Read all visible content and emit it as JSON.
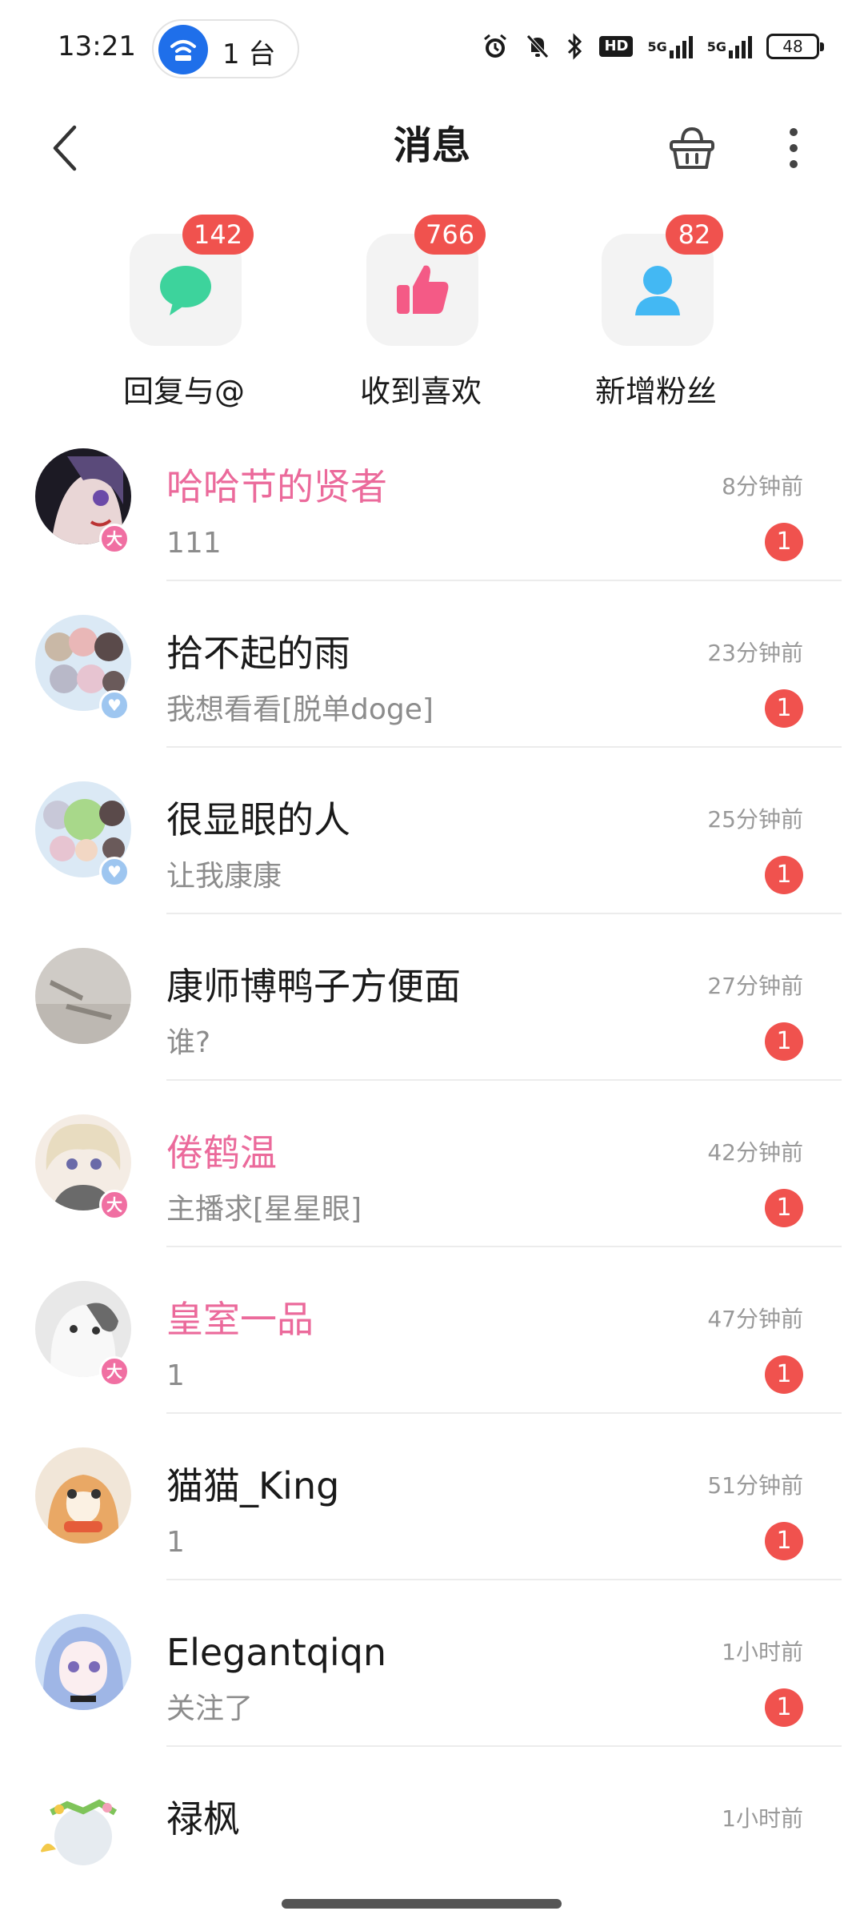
{
  "status_bar": {
    "time": "13:21",
    "hotspot_label": "1 台",
    "network_1": "5G",
    "network_2": "5G",
    "hd_label": "HD",
    "battery": "48"
  },
  "header": {
    "title": "消息"
  },
  "quick_entries": [
    {
      "label": "回复与@",
      "count": "142",
      "icon": "chat-bubble-icon",
      "color": "#3dd39c"
    },
    {
      "label": "收到喜欢",
      "count": "766",
      "icon": "thumbs-up-icon",
      "color": "#f45a86"
    },
    {
      "label": "新增粉丝",
      "count": "82",
      "icon": "person-icon",
      "color": "#43b8f3"
    }
  ],
  "messages": [
    {
      "name": "哈哈节的贤者",
      "preview": "111",
      "time": "8分钟前",
      "unread": "1",
      "vip": true,
      "avatar_badge": "大"
    },
    {
      "name": "拾不起的雨",
      "preview": "我想看看[脱单doge]",
      "time": "23分钟前",
      "unread": "1",
      "vip": false,
      "avatar_badge": "♥"
    },
    {
      "name": "很显眼的人",
      "preview": "让我康康",
      "time": "25分钟前",
      "unread": "1",
      "vip": false,
      "avatar_badge": "♥"
    },
    {
      "name": "康师博鸭子方便面",
      "preview": "谁?",
      "time": "27分钟前",
      "unread": "1",
      "vip": false,
      "avatar_badge": ""
    },
    {
      "name": "倦鹤温",
      "preview": "主播求[星星眼]",
      "time": "42分钟前",
      "unread": "1",
      "vip": true,
      "avatar_badge": "大"
    },
    {
      "name": "皇室一品",
      "preview": "1",
      "time": "47分钟前",
      "unread": "1",
      "vip": true,
      "avatar_badge": "大"
    },
    {
      "name": "猫猫_King",
      "preview": "1",
      "time": "51分钟前",
      "unread": "1",
      "vip": false,
      "avatar_badge": ""
    },
    {
      "name": "Elegantqiqn",
      "preview": "关注了",
      "time": "1小时前",
      "unread": "1",
      "vip": false,
      "avatar_badge": ""
    },
    {
      "name": "禄枫",
      "preview": "",
      "time": "1小时前",
      "unread": "",
      "vip": false,
      "avatar_badge": ""
    }
  ],
  "colors": {
    "accent_pink": "#eb6a9b",
    "badge_red": "#f0524e"
  }
}
